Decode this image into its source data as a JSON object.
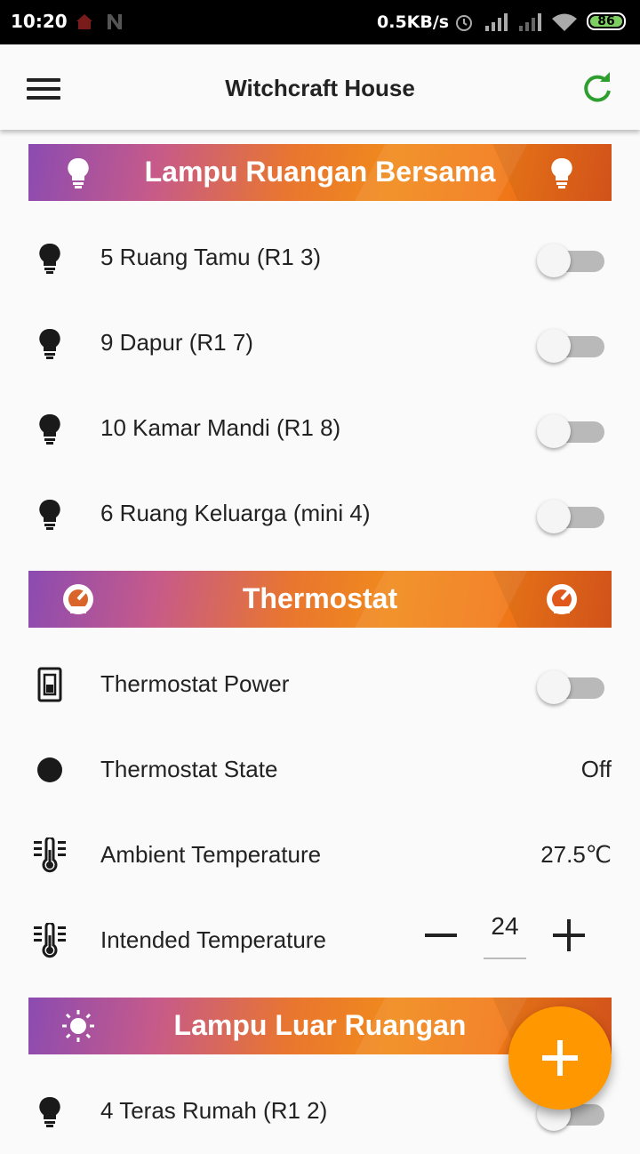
{
  "status_bar": {
    "time": "10:20",
    "net_speed": "0.5KB/s",
    "battery": "86"
  },
  "app_bar": {
    "title": "Witchcraft House",
    "menu_icon": "menu-icon",
    "refresh_icon": "refresh-icon"
  },
  "sections": [
    {
      "title": "Lampu Ruangan Bersama",
      "icon": "lightbulb-icon",
      "items": [
        {
          "label": "5 Ruang Tamu (R1 3)",
          "icon": "bulb-icon",
          "control": "toggle",
          "state": "off"
        },
        {
          "label": "9 Dapur (R1 7)",
          "icon": "bulb-icon",
          "control": "toggle",
          "state": "off"
        },
        {
          "label": "10 Kamar Mandi (R1 8)",
          "icon": "bulb-icon",
          "control": "toggle",
          "state": "off"
        },
        {
          "label": "6 Ruang Keluarga (mini 4)",
          "icon": "bulb-icon",
          "control": "toggle",
          "state": "off"
        }
      ]
    },
    {
      "title": "Thermostat",
      "icon": "gauge-icon",
      "items": [
        {
          "label": "Thermostat Power",
          "icon": "switch-icon",
          "control": "toggle",
          "state": "off"
        },
        {
          "label": "Thermostat State",
          "icon": "dot-icon",
          "control": "text",
          "value": "Off"
        },
        {
          "label": "Ambient Temperature",
          "icon": "thermometer-icon",
          "control": "text",
          "value": "27.5℃"
        },
        {
          "label": "Intended Temperature",
          "icon": "thermometer-icon",
          "control": "stepper",
          "value": "24"
        }
      ]
    },
    {
      "title": "Lampu Luar Ruangan",
      "icon": "sun-icon",
      "items": [
        {
          "label": "4 Teras Rumah (R1 2)",
          "icon": "bulb-icon",
          "control": "toggle",
          "state": "off"
        }
      ]
    }
  ],
  "fab": {
    "icon": "add-icon"
  },
  "colors": {
    "section_gradient_start": "#8b4bb1",
    "section_gradient_mid": "#f08a1c",
    "section_gradient_end": "#e0581c",
    "fab": "#ff9800",
    "refresh": "#2e9e2e",
    "toggle_track_off": "#b9b9b9"
  }
}
